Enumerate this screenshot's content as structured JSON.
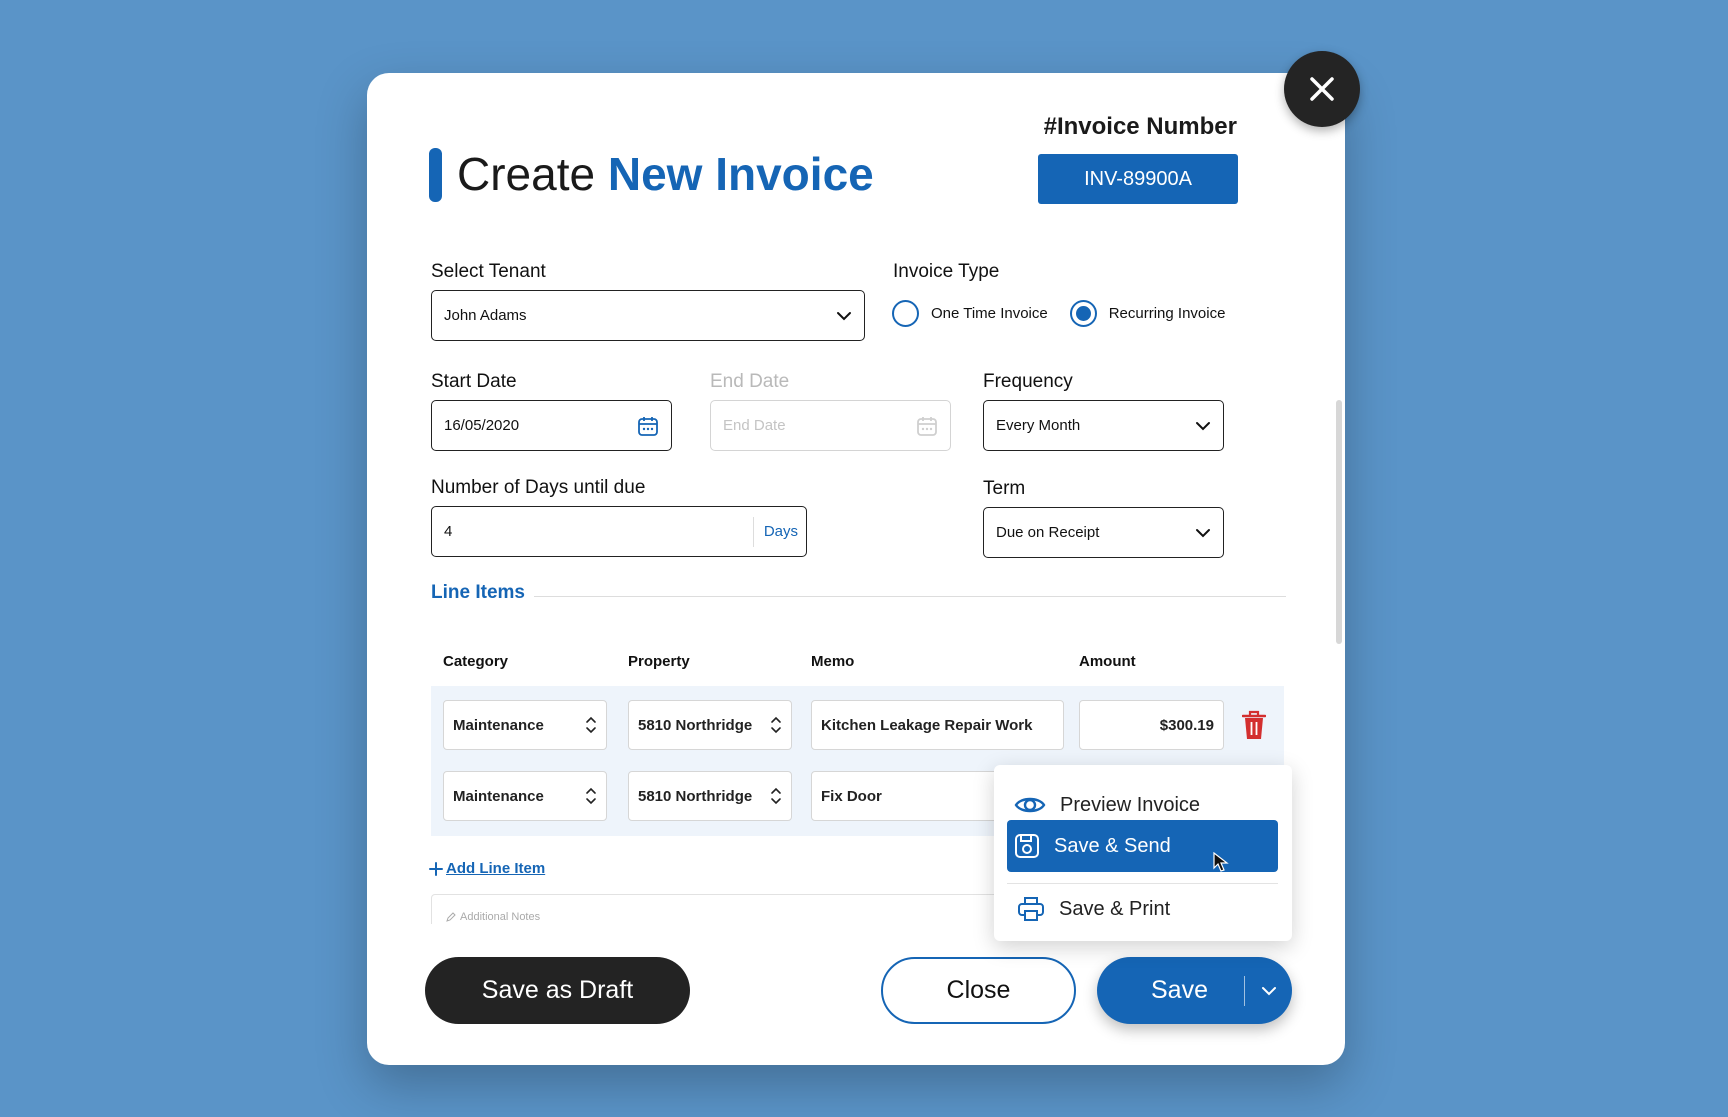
{
  "title": {
    "prefix": "Create",
    "accent": "New Invoice"
  },
  "invoice": {
    "label": "#Invoice Number",
    "number": "INV-89900A"
  },
  "tenant": {
    "label": "Select Tenant",
    "value": "John Adams"
  },
  "invoice_type": {
    "label": "Invoice Type",
    "options": [
      "One Time Invoice",
      "Recurring Invoice"
    ],
    "selected": "Recurring Invoice"
  },
  "start_date": {
    "label": "Start Date",
    "value": "16/05/2020"
  },
  "end_date": {
    "label": "End Date",
    "placeholder": "End Date"
  },
  "frequency": {
    "label": "Frequency",
    "value": "Every Month"
  },
  "days_due": {
    "label": "Number of Days until due",
    "value": "4",
    "suffix": "Days"
  },
  "term": {
    "label": "Term",
    "value": "Due on Receipt"
  },
  "line_items": {
    "title": "Line Items",
    "columns": [
      "Category",
      "Property",
      "Memo",
      "Amount"
    ],
    "rows": [
      {
        "category": "Maintenance",
        "property": "5810 Northridge",
        "memo": "Kitchen Leakage Repair Work",
        "amount": "$300.19"
      },
      {
        "category": "Maintenance",
        "property": "5810 Northridge",
        "memo": "Fix Door",
        "amount": ""
      }
    ],
    "add_label": "Add Line Item"
  },
  "notes": {
    "placeholder": "Additional Notes"
  },
  "buttons": {
    "draft": "Save as Draft",
    "close": "Close",
    "save": "Save"
  },
  "save_menu": {
    "items": [
      {
        "label": "Preview Invoice",
        "icon": "eye-icon"
      },
      {
        "label": "Save & Send",
        "icon": "save-icon"
      },
      {
        "label": "Save & Print",
        "icon": "printer-icon"
      }
    ],
    "highlighted": "Save & Send"
  },
  "colors": {
    "accent": "#1565b5",
    "background": "#5a94c8",
    "dark": "#232323",
    "danger": "#d32f2f"
  }
}
